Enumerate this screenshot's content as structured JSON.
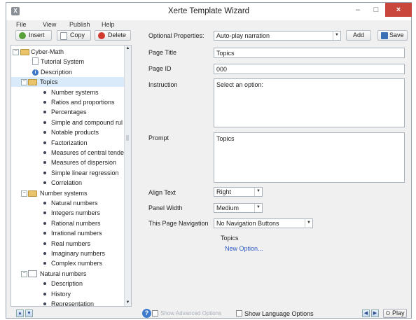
{
  "window": {
    "title": "Xerte Template Wizard",
    "app_icon_glyph": "X",
    "min_glyph": "–",
    "max_glyph": "□",
    "close_glyph": "×"
  },
  "menu": [
    "File",
    "View",
    "Publish",
    "Help"
  ],
  "toolbar": {
    "insert_label": "Insert",
    "copy_label": "Copy",
    "delete_label": "Delete",
    "optional_properties_label": "Optional Properties:",
    "optional_properties_value": "Auto-play narration",
    "add_label": "Add",
    "save_label": "Save"
  },
  "tree": {
    "nodes": [
      {
        "label": "Cyber-Math",
        "icon": "folder-icon",
        "toggle": "−"
      },
      {
        "label": "Tutorial System",
        "icon": "document-icon"
      },
      {
        "label": "Description",
        "icon": "info-icon"
      },
      {
        "label": "Topics",
        "icon": "folder-icon",
        "toggle": "−",
        "selected": true
      },
      {
        "label": "Number systems",
        "icon": "bullet-icon"
      },
      {
        "label": "Ratios and proportions",
        "icon": "bullet-icon"
      },
      {
        "label": "Percentages",
        "icon": "bullet-icon"
      },
      {
        "label": "Simple and compound rul",
        "icon": "bullet-icon"
      },
      {
        "label": "Notable products",
        "icon": "bullet-icon"
      },
      {
        "label": "Factorization",
        "icon": "bullet-icon"
      },
      {
        "label": "Measures of central tende",
        "icon": "bullet-icon"
      },
      {
        "label": "Measures of dispersion",
        "icon": "bullet-icon"
      },
      {
        "label": "Simple linear regression",
        "icon": "bullet-icon"
      },
      {
        "label": "Correlation",
        "icon": "bullet-icon"
      },
      {
        "label": "Number systems",
        "icon": "folder-icon",
        "toggle": "−"
      },
      {
        "label": "Natural numbers",
        "icon": "bullet-icon"
      },
      {
        "label": "Integers numbers",
        "icon": "bullet-icon"
      },
      {
        "label": "Rational numbers",
        "icon": "bullet-icon"
      },
      {
        "label": "Irrational numbers",
        "icon": "bullet-icon"
      },
      {
        "label": "Real numbers",
        "icon": "bullet-icon"
      },
      {
        "label": "Imaginary numbers",
        "icon": "bullet-icon"
      },
      {
        "label": "Complex numbers",
        "icon": "bullet-icon"
      },
      {
        "label": "Natural numbers",
        "icon": "page-icon",
        "toggle": "−"
      },
      {
        "label": "Description",
        "icon": "bullet-icon"
      },
      {
        "label": "History",
        "icon": "bullet-icon"
      },
      {
        "label": "Representation",
        "icon": "bullet-icon"
      }
    ]
  },
  "form": {
    "page_title_label": "Page Title",
    "page_title_value": "Topics",
    "page_id_label": "Page ID",
    "page_id_value": "000",
    "instruction_label": "Instruction",
    "instruction_value": "Select an option:",
    "prompt_label": "Prompt",
    "prompt_value": "Topics",
    "align_text_label": "Align Text",
    "align_text_value": "Right",
    "panel_width_label": "Panel Width",
    "panel_width_value": "Medium",
    "navigation_label": "This Page Navigation",
    "navigation_value": "No Navigation Buttons",
    "topics_caption": "Topics",
    "new_option_label": "New Option..."
  },
  "bottom": {
    "show_advanced_label": "Show Advanced Options",
    "show_language_label": "Show Language Options",
    "play_label": "Play",
    "help_glyph": "?"
  }
}
